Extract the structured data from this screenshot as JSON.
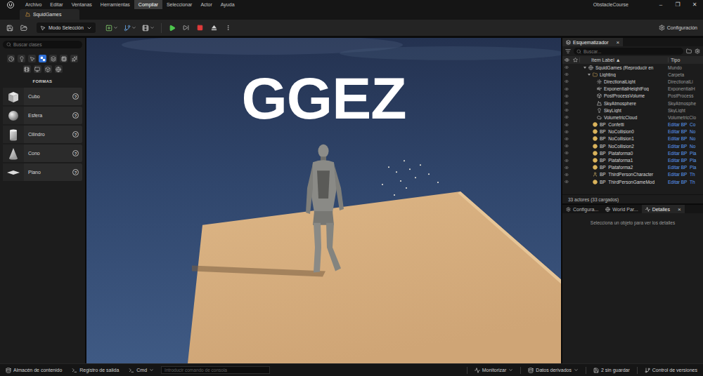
{
  "menu": {
    "items": [
      {
        "label": "Archivo",
        "selected": false
      },
      {
        "label": "Editar",
        "selected": false
      },
      {
        "label": "Ventanas",
        "selected": false
      },
      {
        "label": "Herramientas",
        "selected": false
      },
      {
        "label": "Compilar",
        "selected": true
      },
      {
        "label": "Seleccionar",
        "selected": false
      },
      {
        "label": "Actor",
        "selected": false
      },
      {
        "label": "Ayuda",
        "selected": false
      }
    ],
    "project": "ObstacleCourse",
    "controls": [
      "–",
      "❐",
      "✕"
    ]
  },
  "tabs": [
    {
      "label": "SquidGames",
      "selected": true
    }
  ],
  "toolbar": {
    "mode": "Modo Selección",
    "settings": "Configuración",
    "playing": true
  },
  "place_actors": {
    "search_placeholder": "Buscar clases",
    "category_icons": [
      {
        "selected": false
      },
      {
        "selected": false
      },
      {
        "selected": false
      },
      {
        "selected": true
      },
      {
        "selected": false
      },
      {
        "selected": false
      },
      {
        "selected": false
      },
      {
        "selected": false
      },
      {
        "selected": false
      },
      {
        "selected": false
      },
      {
        "selected": false
      }
    ],
    "category": "FORMAS",
    "items": [
      {
        "label": "Cubo",
        "kind": "cube",
        "help": "?"
      },
      {
        "label": "Esfera",
        "kind": "sphere",
        "help": "?"
      },
      {
        "label": "Cilindro",
        "kind": "cylinder",
        "help": "?"
      },
      {
        "label": "Cono",
        "kind": "cone",
        "help": "?"
      },
      {
        "label": "Plano",
        "kind": "plane",
        "help": "?"
      }
    ]
  },
  "viewport": {
    "overlay_text": "GGEZ"
  },
  "outliner": {
    "title": "Esquematizador",
    "close": "×",
    "search_placeholder": "Buscar...",
    "columns": [
      "Item Label ▲",
      "Tipo"
    ],
    "rows": [
      {
        "label": "SquidGames (Reproducir en",
        "type": "Mundo",
        "kind": "world",
        "depth": 1,
        "expanded": true,
        "link": false
      },
      {
        "label": "Lighting",
        "type": "Carpeta",
        "kind": "folder",
        "depth": 2,
        "expanded": true,
        "link": false
      },
      {
        "label": "DirectionalLight",
        "type": "DirectionalLi",
        "kind": "light",
        "depth": 3,
        "expanded": false,
        "link": false
      },
      {
        "label": "ExponentialHeightFog",
        "type": "ExponentialH",
        "kind": "fog",
        "depth": 3,
        "expanded": false,
        "link": false
      },
      {
        "label": "PostProcessVolume",
        "type": "PostProcess",
        "kind": "post",
        "depth": 3,
        "expanded": false,
        "link": false
      },
      {
        "label": "SkyAtmosphere",
        "type": "SkyAtmosphe",
        "kind": "sky",
        "depth": 3,
        "expanded": false,
        "link": false
      },
      {
        "label": "SkyLight",
        "type": "SkyLight",
        "kind": "skylight",
        "depth": 3,
        "expanded": false,
        "link": false
      },
      {
        "label": "VolumetricCloud",
        "type": "VolumetricClo",
        "kind": "cloud",
        "depth": 3,
        "expanded": false,
        "link": false
      },
      {
        "label": "BP_Confetti",
        "type": "Editar BP_Co",
        "kind": "blueprint",
        "depth": 2,
        "expanded": false,
        "link": true
      },
      {
        "label": "BP_NoCollision0",
        "type": "Editar BP_No",
        "kind": "blueprint",
        "depth": 2,
        "expanded": false,
        "link": true
      },
      {
        "label": "BP_NoCollision1",
        "type": "Editar BP_No",
        "kind": "blueprint",
        "depth": 2,
        "expanded": false,
        "link": true
      },
      {
        "label": "BP_NoCollision2",
        "type": "Editar BP_No",
        "kind": "blueprint",
        "depth": 2,
        "expanded": false,
        "link": true
      },
      {
        "label": "BP_Plataforma0",
        "type": "Editar BP_Pla",
        "kind": "blueprint",
        "depth": 2,
        "expanded": false,
        "link": true
      },
      {
        "label": "BP_Plataforma1",
        "type": "Editar BP_Pla",
        "kind": "blueprint",
        "depth": 2,
        "expanded": false,
        "link": true
      },
      {
        "label": "BP_Plataforma2",
        "type": "Editar BP_Pla",
        "kind": "blueprint",
        "depth": 2,
        "expanded": false,
        "link": true
      },
      {
        "label": "BP_ThirdPersonCharacter",
        "type": "Editar BP_Th",
        "kind": "character",
        "depth": 2,
        "expanded": false,
        "link": true
      },
      {
        "label": "BP_ThirdPersonGameMod",
        "type": "Editar BP_Th",
        "kind": "blueprint",
        "depth": 2,
        "expanded": false,
        "link": true
      }
    ],
    "summary": "33 actores (33 cargados)"
  },
  "details": {
    "tabs": [
      {
        "label": "Configura...",
        "selected": false
      },
      {
        "label": "World Par...",
        "selected": false
      },
      {
        "label": "Detalles",
        "selected": true
      }
    ],
    "close": "×",
    "empty": "Selecciona un objeto para ver los detalles"
  },
  "status_bar": {
    "left": [
      "Almacén de contenido",
      "Registro de salida"
    ],
    "cmd": "Cmd",
    "console_placeholder": "Introducir comando de consola",
    "right": [
      "Monitorizar",
      "Datos derivados",
      "2 sin guardar",
      "Control de versiones"
    ]
  }
}
